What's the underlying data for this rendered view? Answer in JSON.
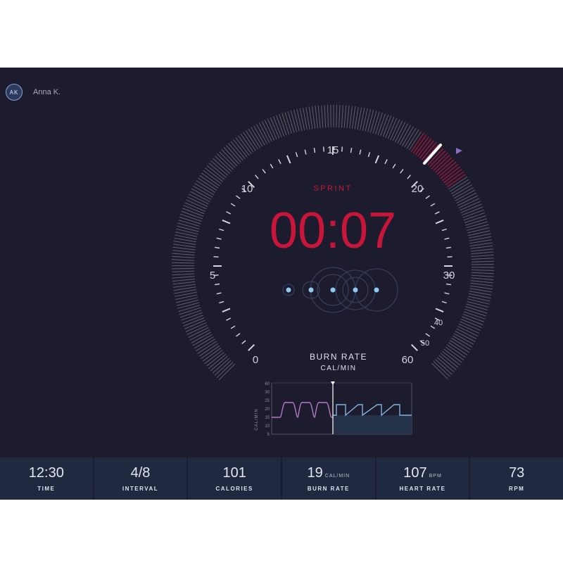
{
  "user": {
    "initials": "AK",
    "name": "Anna K."
  },
  "timer": {
    "phase": "SPRINT",
    "time": "00:07"
  },
  "dial": {
    "labels": [
      "0",
      "5",
      "10",
      "15",
      "20",
      "30",
      "40",
      "50",
      "60"
    ],
    "needle_value": 20,
    "accent_color": "#c8163a",
    "marker_color": "#8a6cc0"
  },
  "intervals": {
    "count": 5,
    "active": 3
  },
  "burn_chart": {
    "title": "BURN RATE",
    "subtitle": "CAL/MIN",
    "ylabel": "CAL/MIN",
    "yticks": [
      "60",
      "30",
      "25",
      "20",
      "15",
      "10",
      "5"
    ]
  },
  "stats": [
    {
      "value": "12:30",
      "unit": "",
      "label": "TIME"
    },
    {
      "value": "4/8",
      "unit": "",
      "label": "INTERVAL"
    },
    {
      "value": "101",
      "unit": "",
      "label": "CALORIES"
    },
    {
      "value": "19",
      "unit": "CAL/MIN",
      "label": "BURN RATE"
    },
    {
      "value": "107",
      "unit": "BPM",
      "label": "HEART RATE"
    },
    {
      "value": "73",
      "unit": "",
      "label": "RPM"
    }
  ],
  "colors": {
    "background": "#1c1c2e",
    "stat_panel": "#1f2a40",
    "timer": "#c8163a",
    "interval_dot": "#8ecbf2",
    "chart_past": "#b67ac8",
    "chart_future": "#7fb3dc"
  }
}
